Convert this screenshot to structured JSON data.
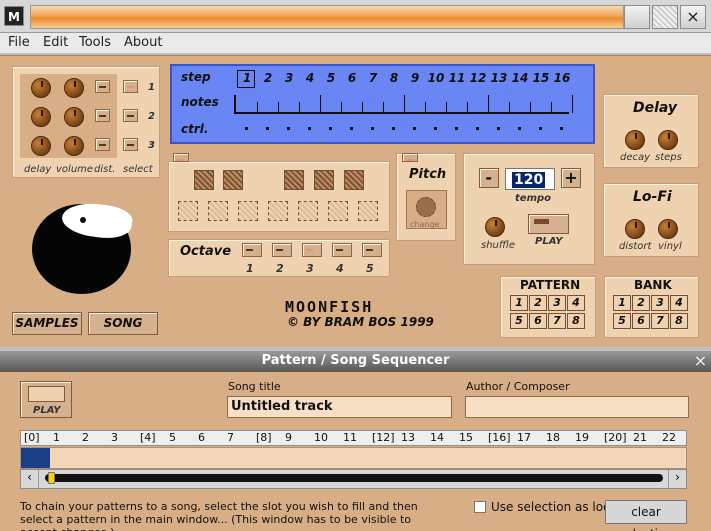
{
  "window": {
    "logo": "M",
    "controls": [
      "",
      "",
      ""
    ]
  },
  "menu": [
    "File",
    "Edit",
    "Tools",
    "About"
  ],
  "mixer": {
    "labels": [
      "delay",
      "volume",
      "dist.",
      "select"
    ],
    "select_numbers": [
      "1",
      "2",
      "3"
    ]
  },
  "lcd": {
    "step": "step",
    "notes": "notes",
    "ctrl": "ctrl.",
    "steps": [
      "1",
      "2",
      "3",
      "4",
      "5",
      "6",
      "7",
      "8",
      "9",
      "10",
      "11",
      "12",
      "13",
      "14",
      "15",
      "16"
    ]
  },
  "octave": {
    "title": "Octave",
    "numbers": [
      "1",
      "2",
      "3",
      "4",
      "5"
    ]
  },
  "pitch": {
    "title": "Pitch",
    "change": "change"
  },
  "tempo": {
    "minus": "-",
    "plus": "+",
    "value": "120",
    "label": "tempo",
    "shuffle": "shuffle",
    "play": "PLAY"
  },
  "delay": {
    "title": "Delay",
    "decay": "decay",
    "steps": "steps"
  },
  "lofi": {
    "title": "Lo-Fi",
    "distort": "distort",
    "vinyl": "vinyl"
  },
  "pattern": {
    "title": "PATTERN",
    "numbers": [
      "1",
      "2",
      "3",
      "4",
      "5",
      "6",
      "7",
      "8"
    ]
  },
  "bank": {
    "title": "BANK",
    "numbers": [
      "1",
      "2",
      "3",
      "4",
      "5",
      "6",
      "7",
      "8"
    ]
  },
  "buttons": {
    "samples": "SAMPLES",
    "song": "SONG"
  },
  "branding": {
    "name": "MOONFISH",
    "copyright": "© BY BRAM BOS 1999"
  },
  "sequencer": {
    "title": "Pattern / Song Sequencer",
    "play": "PLAY",
    "song_title_label": "Song title",
    "song_title_value": "Untitled track",
    "author_label": "Author / Composer",
    "author_value": "",
    "slots": [
      "[0]",
      "1",
      "2",
      "3",
      "[4]",
      "5",
      "6",
      "7",
      "[8]",
      "9",
      "10",
      "11",
      "[12]",
      "13",
      "14",
      "15",
      "[16]",
      "17",
      "18",
      "19",
      "[20]",
      "21",
      "22"
    ],
    "instructions": "To chain your patterns to a song, select the slot you wish to fill and then select a pattern in the main window... (This window has to be visible to accept changes.)",
    "loop_label": "Use selection as loop",
    "clear_selection": "clear selection",
    "close": "×"
  },
  "colors": {
    "accent": "#eb8a2f",
    "lcd": "#6a86f4",
    "panel": "#efd3b0",
    "background": "#d8ae86"
  }
}
